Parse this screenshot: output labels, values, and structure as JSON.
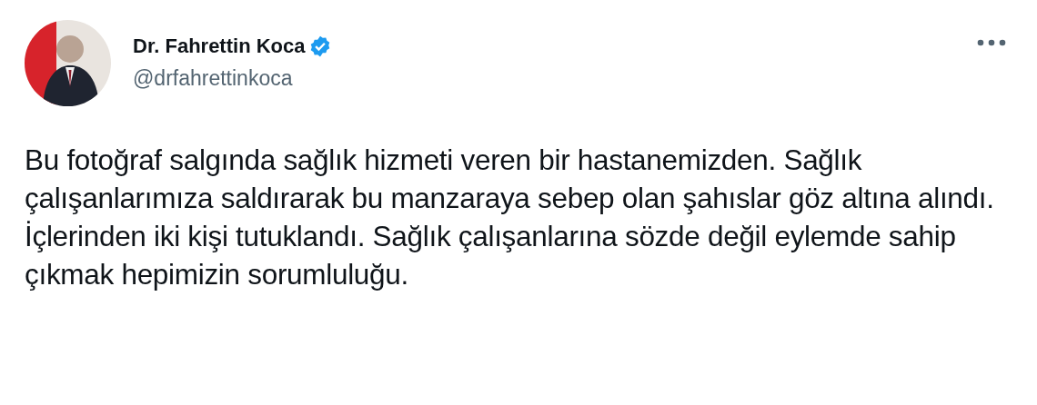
{
  "author": {
    "name": "Dr. Fahrettin Koca",
    "verified": true,
    "handle": "@drfahrettinkoca"
  },
  "text": "Bu fotoğraf salgında sağlık hizmeti veren bir hastanemizden. Sağlık çalışanlarımıza saldırarak bu manzaraya sebep olan şahıslar göz altına alındı. İçlerinden iki kişi tutuklandı. Sağlık çalışanlarına sözde değil eylemde sahip çıkmak hepimizin sorumluluğu."
}
